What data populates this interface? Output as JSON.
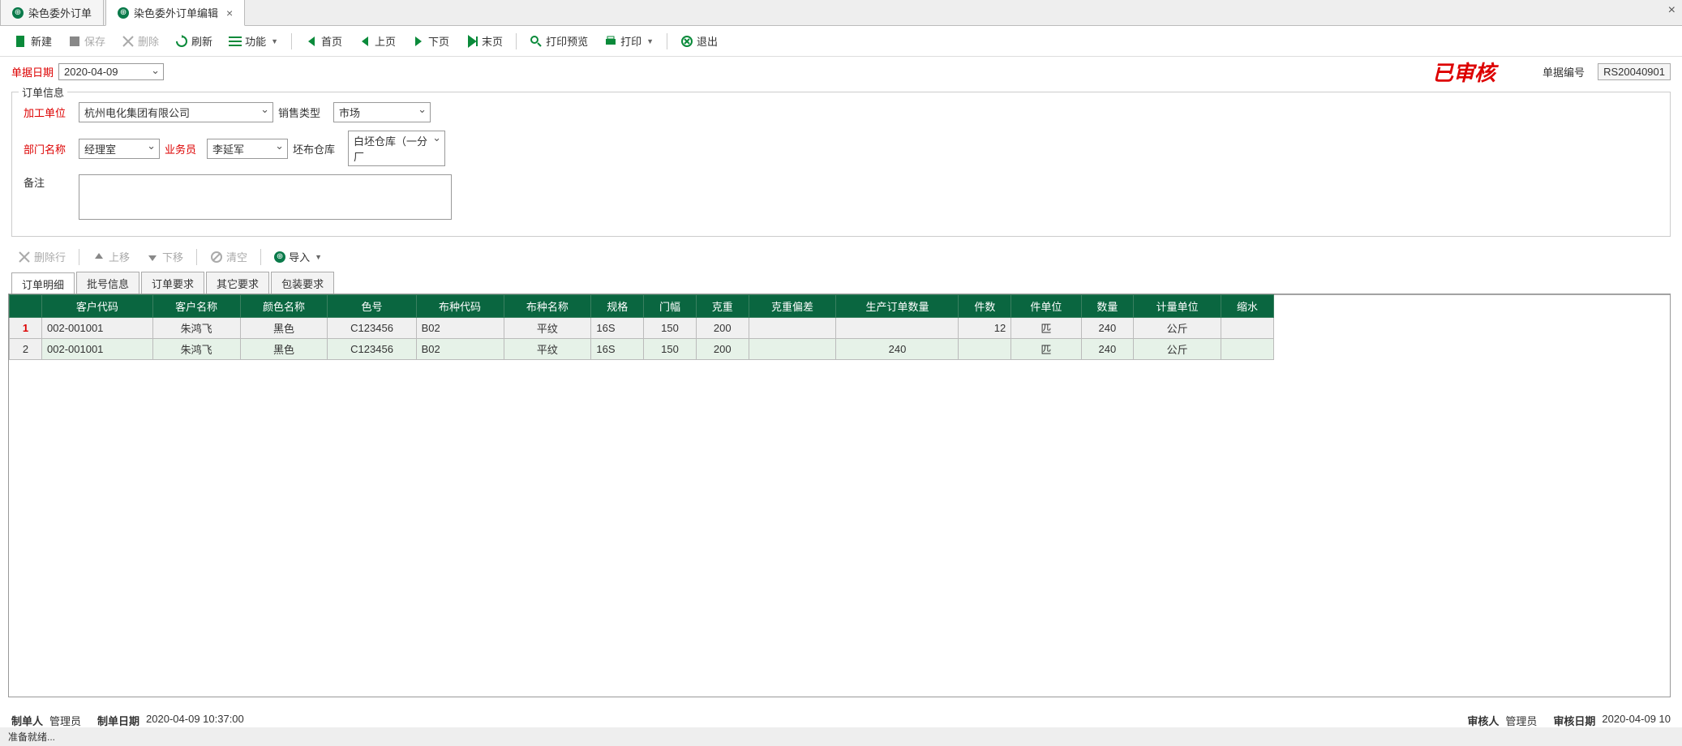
{
  "tabs": {
    "list": "染色委外订单",
    "edit": "染色委外订单编辑"
  },
  "toolbar": {
    "new": "新建",
    "save": "保存",
    "delete": "删除",
    "refresh": "刷新",
    "func": "功能",
    "first": "首页",
    "prev": "上页",
    "next": "下页",
    "last": "末页",
    "preview": "打印预览",
    "print": "打印",
    "exit": "退出"
  },
  "header": {
    "date_label": "单据日期",
    "date_val": "2020-04-09",
    "approved": "已审核",
    "docno_label": "单据编号",
    "docno_val": "RS20040901"
  },
  "fs": {
    "title": "订单信息",
    "proc_unit_l": "加工单位",
    "proc_unit_v": "杭州电化集团有限公司",
    "sale_type_l": "销售类型",
    "sale_type_v": "市场",
    "dept_l": "部门名称",
    "dept_v": "经理室",
    "sales_l": "业务员",
    "sales_v": "李延军",
    "wh_l": "坯布仓库",
    "wh_v": "白坯仓库（一分厂",
    "remark_l": "备注",
    "remark_v": ""
  },
  "subbar": {
    "delrow": "删除行",
    "up": "上移",
    "down": "下移",
    "clear": "清空",
    "import": "导入"
  },
  "subtabs": [
    "订单明细",
    "批号信息",
    "订单要求",
    "其它要求",
    "包装要求"
  ],
  "grid": {
    "cols": [
      "客户代码",
      "客户名称",
      "颜色名称",
      "色号",
      "布种代码",
      "布种名称",
      "规格",
      "门幅",
      "克重",
      "克重偏差",
      "生产订单数量",
      "件数",
      "件单位",
      "数量",
      "计量单位",
      "缩水"
    ],
    "rows": [
      {
        "n": "1",
        "sel": true,
        "cust": "002-001001",
        "cname": "朱鸿飞",
        "color": "黑色",
        "colno": "C123456",
        "clothc": "B02",
        "clothn": "平纹",
        "spec": "16S",
        "width": "150",
        "weight": "200",
        "wdev": "",
        "prodqty": "",
        "pcs": "12",
        "pcunit": "匹",
        "qty": "240",
        "unit": "公斤"
      },
      {
        "n": "2",
        "sel": false,
        "cust": "002-001001",
        "cname": "朱鸿飞",
        "color": "黑色",
        "colno": "C123456",
        "clothc": "B02",
        "clothn": "平纹",
        "spec": "16S",
        "width": "150",
        "weight": "200",
        "wdev": "",
        "prodqty": "240",
        "pcs": "",
        "pcunit": "匹",
        "qty": "240",
        "unit": "公斤"
      }
    ]
  },
  "footer": {
    "maker_l": "制单人",
    "maker_v": "管理员",
    "makedate_l": "制单日期",
    "makedate_v": "2020-04-09 10:37:00",
    "auditor_l": "审核人",
    "auditor_v": "管理员",
    "auditdate_l": "审核日期",
    "auditdate_v": "2020-04-09 10"
  },
  "status": "准备就绪..."
}
